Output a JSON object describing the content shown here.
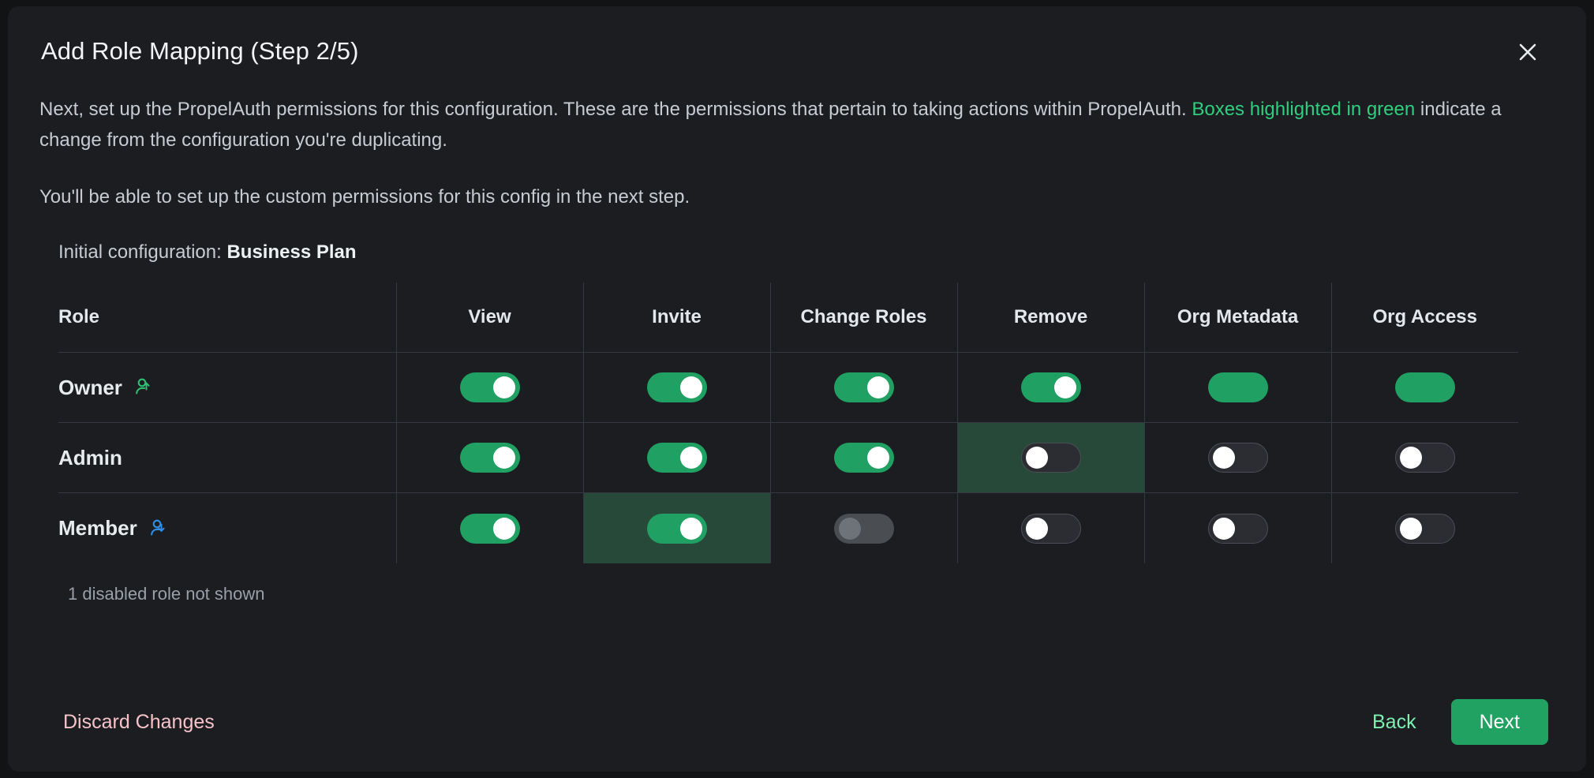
{
  "modal": {
    "title": "Add Role Mapping (Step 2/5)",
    "close_icon": "close-icon",
    "description": {
      "part1": "Next, set up the PropelAuth permissions for this configuration. These are the permissions that pertain to taking actions within PropelAuth. ",
      "highlight": "Boxes highlighted in green",
      "part2": " indicate a change from the configuration you're duplicating."
    },
    "description_second": "You'll be able to set up the custom permissions for this config in the next step.",
    "initial_config_label": "Initial configuration:",
    "initial_config_value": "Business Plan",
    "note": "1 disabled role not shown"
  },
  "table": {
    "headers": [
      "Role",
      "View",
      "Invite",
      "Change Roles",
      "Remove",
      "Org Metadata",
      "Org Access"
    ],
    "rows": [
      {
        "role": "Owner",
        "icon": "user-promote-icon",
        "icon_color": "#2fbf72",
        "cells": [
          {
            "state": "on",
            "highlight": false
          },
          {
            "state": "on",
            "highlight": false
          },
          {
            "state": "on",
            "highlight": false
          },
          {
            "state": "on",
            "highlight": false
          },
          {
            "state": "locked",
            "highlight": false
          },
          {
            "state": "locked",
            "highlight": false
          }
        ]
      },
      {
        "role": "Admin",
        "icon": null,
        "icon_color": null,
        "cells": [
          {
            "state": "on",
            "highlight": false
          },
          {
            "state": "on",
            "highlight": false
          },
          {
            "state": "on",
            "highlight": false
          },
          {
            "state": "off",
            "highlight": true
          },
          {
            "state": "off",
            "highlight": false
          },
          {
            "state": "off",
            "highlight": false
          }
        ]
      },
      {
        "role": "Member",
        "icon": "user-demote-icon",
        "icon_color": "#2f8fe8",
        "cells": [
          {
            "state": "on",
            "highlight": false
          },
          {
            "state": "on",
            "highlight": true
          },
          {
            "state": "disabled",
            "highlight": false
          },
          {
            "state": "off",
            "highlight": false
          },
          {
            "state": "off",
            "highlight": false
          },
          {
            "state": "off",
            "highlight": false
          }
        ]
      }
    ]
  },
  "footer": {
    "discard_label": "Discard Changes",
    "back_label": "Back",
    "next_label": "Next"
  },
  "colors": {
    "accent_green": "#20a062",
    "link_green": "#2fcf7f",
    "back_green": "#7ef0b1",
    "discard_pink": "#f6c3c9",
    "highlight_cell": "#27493a",
    "modal_bg": "#1b1d21",
    "page_bg": "#111315"
  }
}
